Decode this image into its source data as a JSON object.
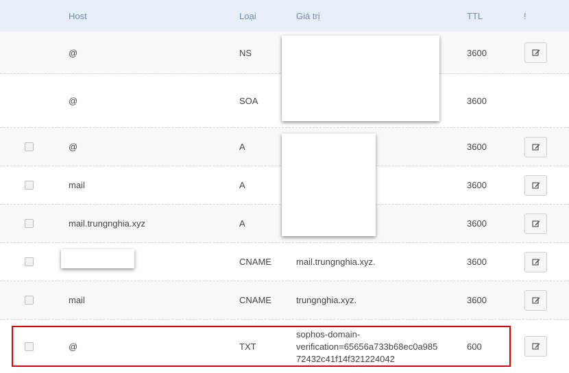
{
  "table": {
    "headers": {
      "host": "Host",
      "type": "Loại",
      "value": "Giá trị",
      "ttl": "TTL",
      "action": "!"
    },
    "rows": [
      {
        "host": "@",
        "type": "NS",
        "value": "",
        "ttl": "3600"
      },
      {
        "host": "@",
        "type": "SOA",
        "value": "",
        "ttl": "3600"
      },
      {
        "host": "@",
        "type": "A",
        "value": "",
        "ttl": "3600"
      },
      {
        "host": "mail",
        "type": "A",
        "value": "",
        "ttl": "3600"
      },
      {
        "host": "mail.trungnghia.xyz",
        "type": "A",
        "value": "",
        "ttl": "3600"
      },
      {
        "host": "",
        "type": "CNAME",
        "value": "mail.trungnghia.xyz.",
        "ttl": "3600"
      },
      {
        "host": "mail",
        "type": "CNAME",
        "value": "trungnghia.xyz.",
        "ttl": "3600"
      },
      {
        "host": "@",
        "type": "TXT",
        "value": "sophos-domain-verification=65656a733b68ec0a98572432c41f14f321224042",
        "value_lines": [
          "sophos-domain-",
          "verification=65656a733b68ec0a985",
          "72432c41f14f321224042"
        ],
        "ttl": "600"
      }
    ]
  },
  "icons": {
    "checkbox": "checkbox-icon",
    "edit": "edit-icon"
  },
  "colors": {
    "header_bg": "#e8eef7",
    "header_text": "#6f89b0",
    "highlight": "#e00000"
  }
}
